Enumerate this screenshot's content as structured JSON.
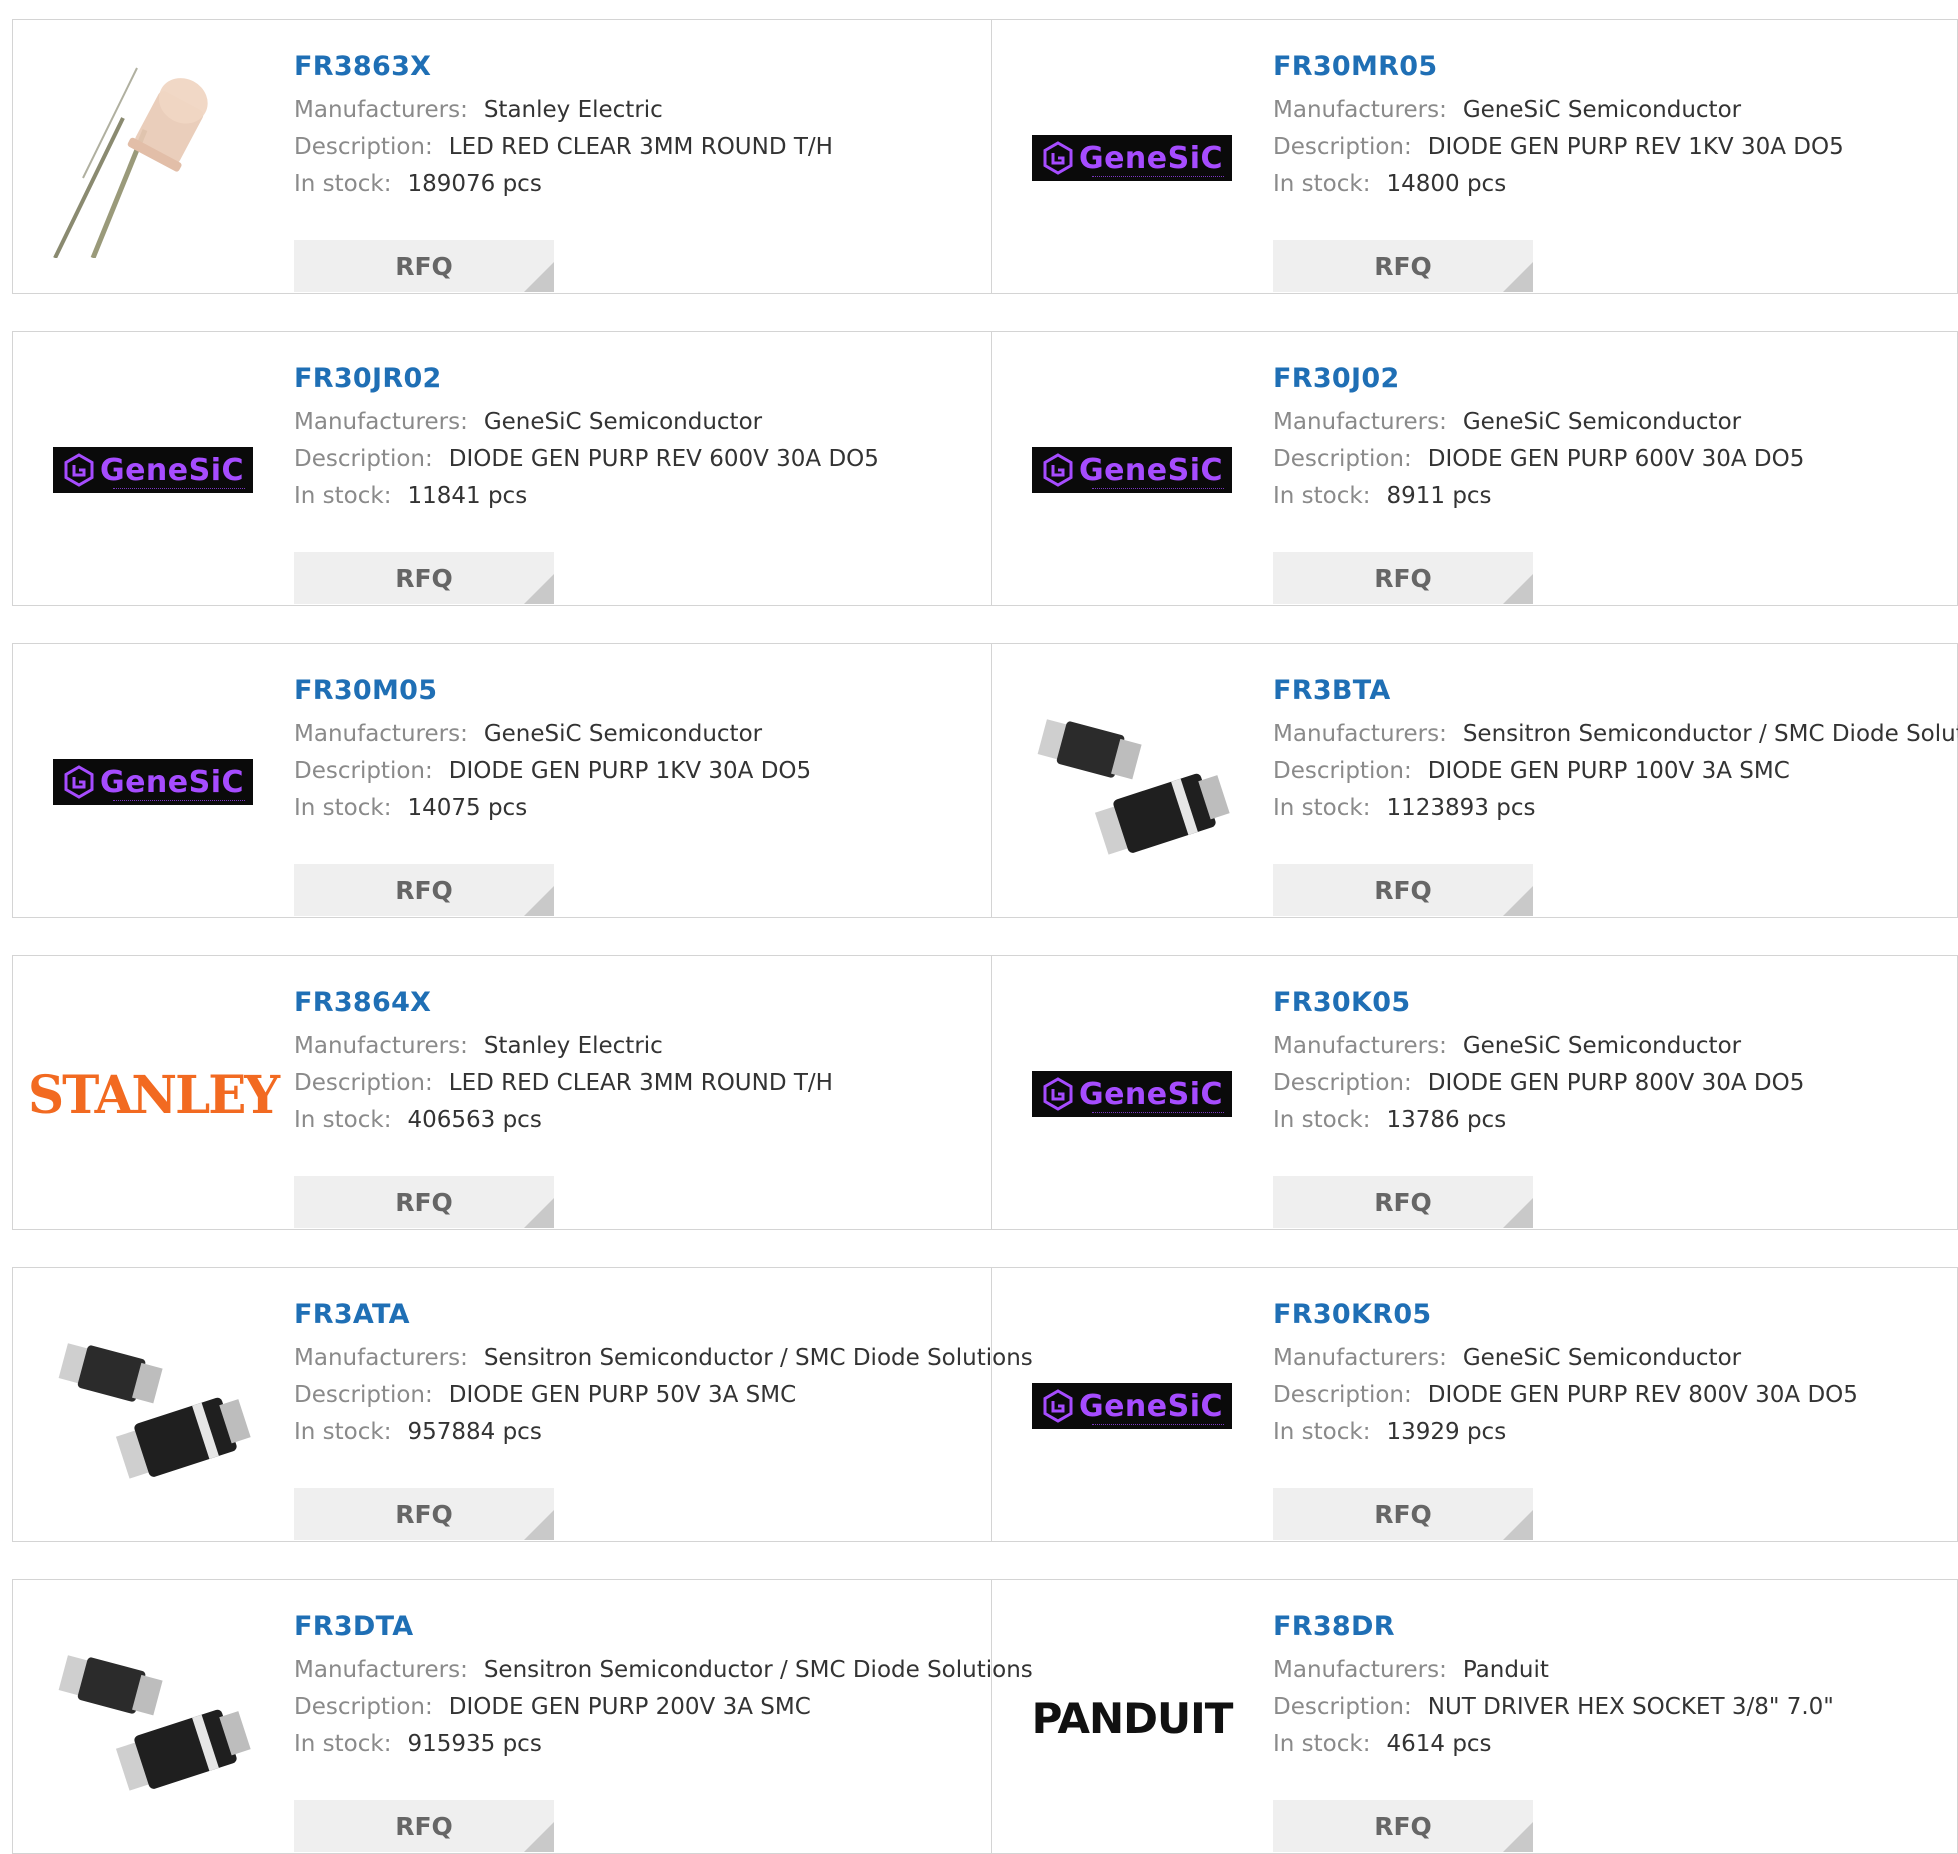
{
  "labels": {
    "manufacturers": "Manufacturers:",
    "description": "Description:",
    "in_stock": "In stock:",
    "rfq": "RFQ"
  },
  "brand_colors": {
    "link": "#1f6fb5",
    "genesic_purple": "#a64cff",
    "stanley_orange": "#f26a21"
  },
  "products": [
    {
      "part": "FR3863X",
      "manufacturer": "Stanley Electric",
      "description": "LED RED CLEAR 3MM ROUND T/H",
      "stock": "189076 pcs",
      "image": "led-3mm-photo"
    },
    {
      "part": "FR30MR05",
      "manufacturer": "GeneSiC Semiconductor",
      "description": "DIODE GEN PURP REV 1KV 30A DO5",
      "stock": "14800 pcs",
      "image": "genesic-logo",
      "logo_text": "GeneSiC"
    },
    {
      "part": "FR30JR02",
      "manufacturer": "GeneSiC Semiconductor",
      "description": "DIODE GEN PURP REV 600V 30A DO5",
      "stock": "11841 pcs",
      "image": "genesic-logo",
      "logo_text": "GeneSiC"
    },
    {
      "part": "FR30J02",
      "manufacturer": "GeneSiC Semiconductor",
      "description": "DIODE GEN PURP 600V 30A DO5",
      "stock": "8911 pcs",
      "image": "genesic-logo",
      "logo_text": "GeneSiC"
    },
    {
      "part": "FR30M05",
      "manufacturer": "GeneSiC Semiconductor",
      "description": "DIODE GEN PURP 1KV 30A DO5",
      "stock": "14075 pcs",
      "image": "genesic-logo",
      "logo_text": "GeneSiC"
    },
    {
      "part": "FR3BTA",
      "manufacturer": "Sensitron Semiconductor / SMC Diode Solutions",
      "description": "DIODE GEN PURP 100V 3A SMC",
      "stock": "1123893 pcs",
      "image": "smc-diode-photo"
    },
    {
      "part": "FR3864X",
      "manufacturer": "Stanley Electric",
      "description": "LED RED CLEAR 3MM ROUND T/H",
      "stock": "406563 pcs",
      "image": "stanley-logo",
      "logo_text": "STANLEY"
    },
    {
      "part": "FR30K05",
      "manufacturer": "GeneSiC Semiconductor",
      "description": "DIODE GEN PURP 800V 30A DO5",
      "stock": "13786 pcs",
      "image": "genesic-logo",
      "logo_text": "GeneSiC"
    },
    {
      "part": "FR3ATA",
      "manufacturer": "Sensitron Semiconductor / SMC Diode Solutions",
      "description": "DIODE GEN PURP 50V 3A SMC",
      "stock": "957884 pcs",
      "image": "smc-diode-photo"
    },
    {
      "part": "FR30KR05",
      "manufacturer": "GeneSiC Semiconductor",
      "description": "DIODE GEN PURP REV 800V 30A DO5",
      "stock": "13929 pcs",
      "image": "genesic-logo",
      "logo_text": "GeneSiC"
    },
    {
      "part": "FR3DTA",
      "manufacturer": "Sensitron Semiconductor / SMC Diode Solutions",
      "description": "DIODE GEN PURP 200V 3A SMC",
      "stock": "915935 pcs",
      "image": "smc-diode-photo"
    },
    {
      "part": "FR38DR",
      "manufacturer": "Panduit",
      "description": "NUT DRIVER HEX SOCKET 3/8\" 7.0\"",
      "stock": "4614 pcs",
      "image": "panduit-logo",
      "logo_text": "PANDUIT"
    }
  ]
}
